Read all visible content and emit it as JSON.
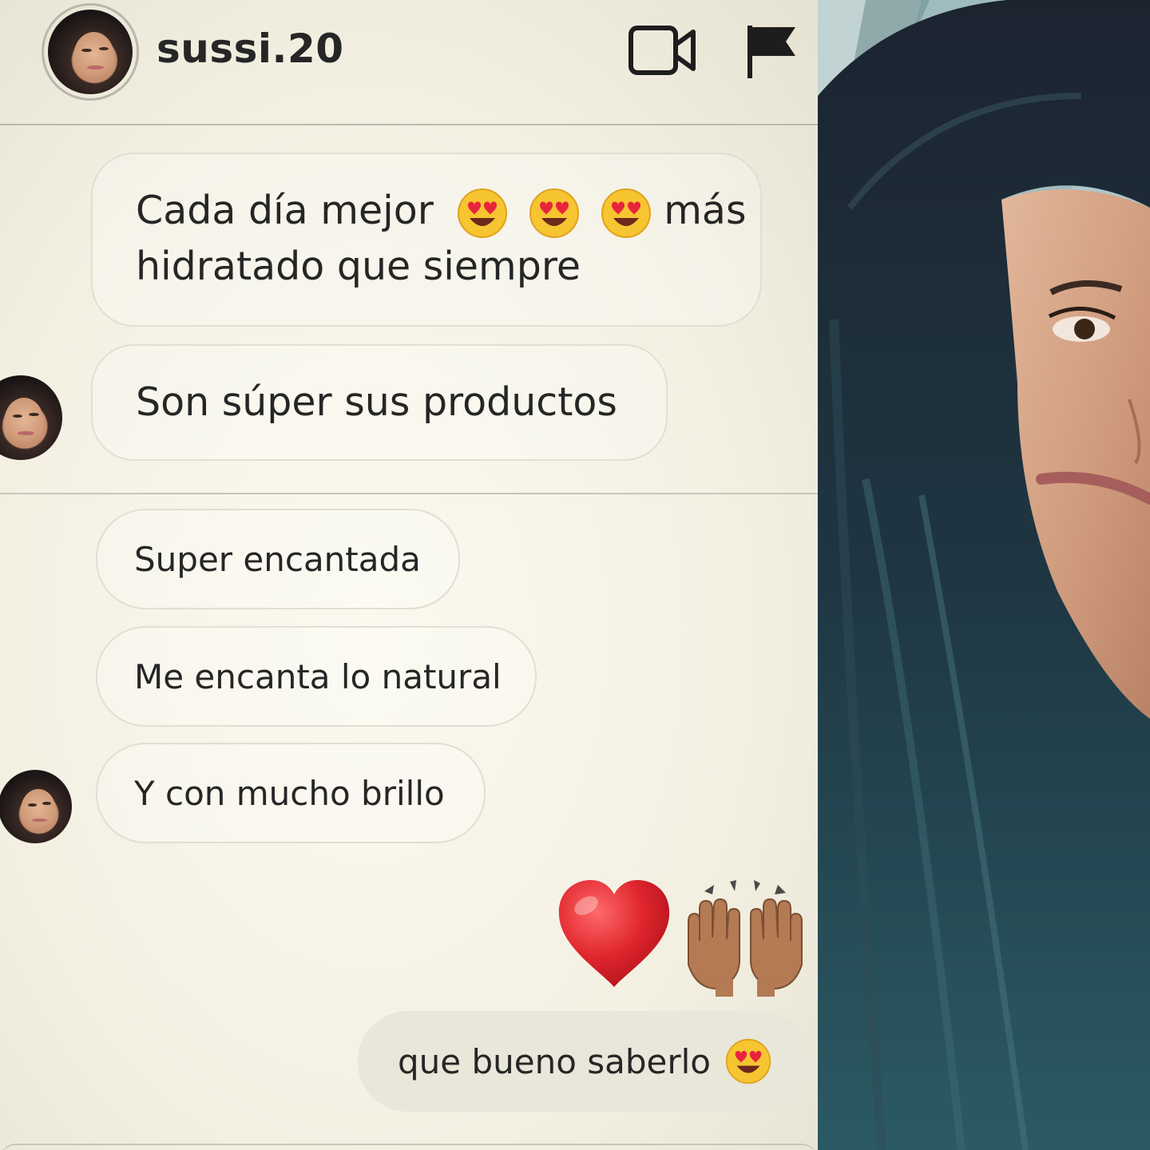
{
  "conversation": {
    "username": "sussi.20",
    "header_icons": [
      "video-call-icon",
      "report-flag-icon"
    ]
  },
  "messages": [
    {
      "line1": "Cada día mejor",
      "line1_end": "más",
      "line2": "hidratado que siempre",
      "emoji_count": 3,
      "emoji": "heart-eyes-emoji"
    },
    {
      "text": "Son súper sus productos"
    },
    {
      "text": "Super encantada"
    },
    {
      "text": "Me encanta lo natural"
    },
    {
      "text": "Y con mucho brillo"
    }
  ],
  "reactions": [
    "red-heart-emoji",
    "raising-hands-emoji"
  ],
  "reply": {
    "text": "que bueno saberlo",
    "emoji": "heart-eyes-emoji"
  },
  "colors": {
    "background": "#f3f0e2",
    "text": "#262626",
    "bubble_border": "#e2ded2",
    "sent_bubble": "#e9e6da",
    "heart": "#e0262e"
  },
  "photo": {
    "subject": "selfie-photo"
  }
}
